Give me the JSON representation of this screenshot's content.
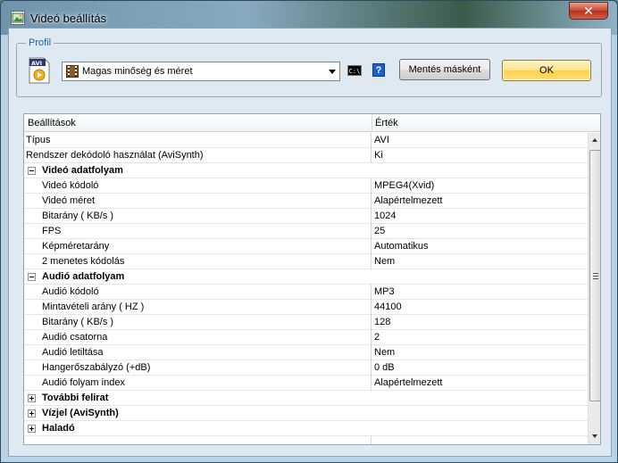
{
  "window": {
    "title": "Videó beállítás",
    "close_glyph": "✕"
  },
  "profile": {
    "legend": "Profil",
    "selected": "Magas minőség és méret",
    "cmd_icon_text": "C:\\",
    "help_glyph": "?",
    "save_as_label": "Mentés másként",
    "ok_label": "OK"
  },
  "grid": {
    "col_name": "Beállítások",
    "col_value": "Érték",
    "rows": [
      {
        "type": "item",
        "name": "Típus",
        "value": "AVI"
      },
      {
        "type": "item",
        "name": "Rendszer dekódoló használat (AviSynth)",
        "value": "Ki"
      },
      {
        "type": "category",
        "name": "Videó adatfolyam",
        "expanded": true
      },
      {
        "type": "child",
        "name": "Videó kódoló",
        "value": "MPEG4(Xvid)"
      },
      {
        "type": "child",
        "name": "Videó méret",
        "value": "Alapértelmezett"
      },
      {
        "type": "child",
        "name": "Bitarány ( KB/s )",
        "value": "1024"
      },
      {
        "type": "child",
        "name": "FPS",
        "value": "25"
      },
      {
        "type": "child",
        "name": "Képméretarány",
        "value": "Automatikus"
      },
      {
        "type": "child",
        "name": "2 menetes kódolás",
        "value": "Nem"
      },
      {
        "type": "category",
        "name": "Audió adatfolyam",
        "expanded": true
      },
      {
        "type": "child",
        "name": "Audió kódoló",
        "value": "MP3"
      },
      {
        "type": "child",
        "name": "Mintavételi arány ( HZ )",
        "value": "44100"
      },
      {
        "type": "child",
        "name": "Bitarány ( KB/s )",
        "value": "128"
      },
      {
        "type": "child",
        "name": "Audió csatorna",
        "value": "2"
      },
      {
        "type": "child",
        "name": "Audió letiltása",
        "value": "Nem"
      },
      {
        "type": "child",
        "name": "Hangerőszabályzó (+dB)",
        "value": "0 dB"
      },
      {
        "type": "child",
        "name": "Audió folyam index",
        "value": "Alapértelmezett"
      },
      {
        "type": "category",
        "name": "További felirat",
        "expanded": false
      },
      {
        "type": "category",
        "name": "Vízjel (AviSynth)",
        "expanded": false
      },
      {
        "type": "category",
        "name": "Haladó",
        "expanded": false
      }
    ]
  },
  "colors": {
    "accent_legend": "#1e5ea8",
    "ok_button": "#ffd24a",
    "close_button": "#c74532"
  }
}
